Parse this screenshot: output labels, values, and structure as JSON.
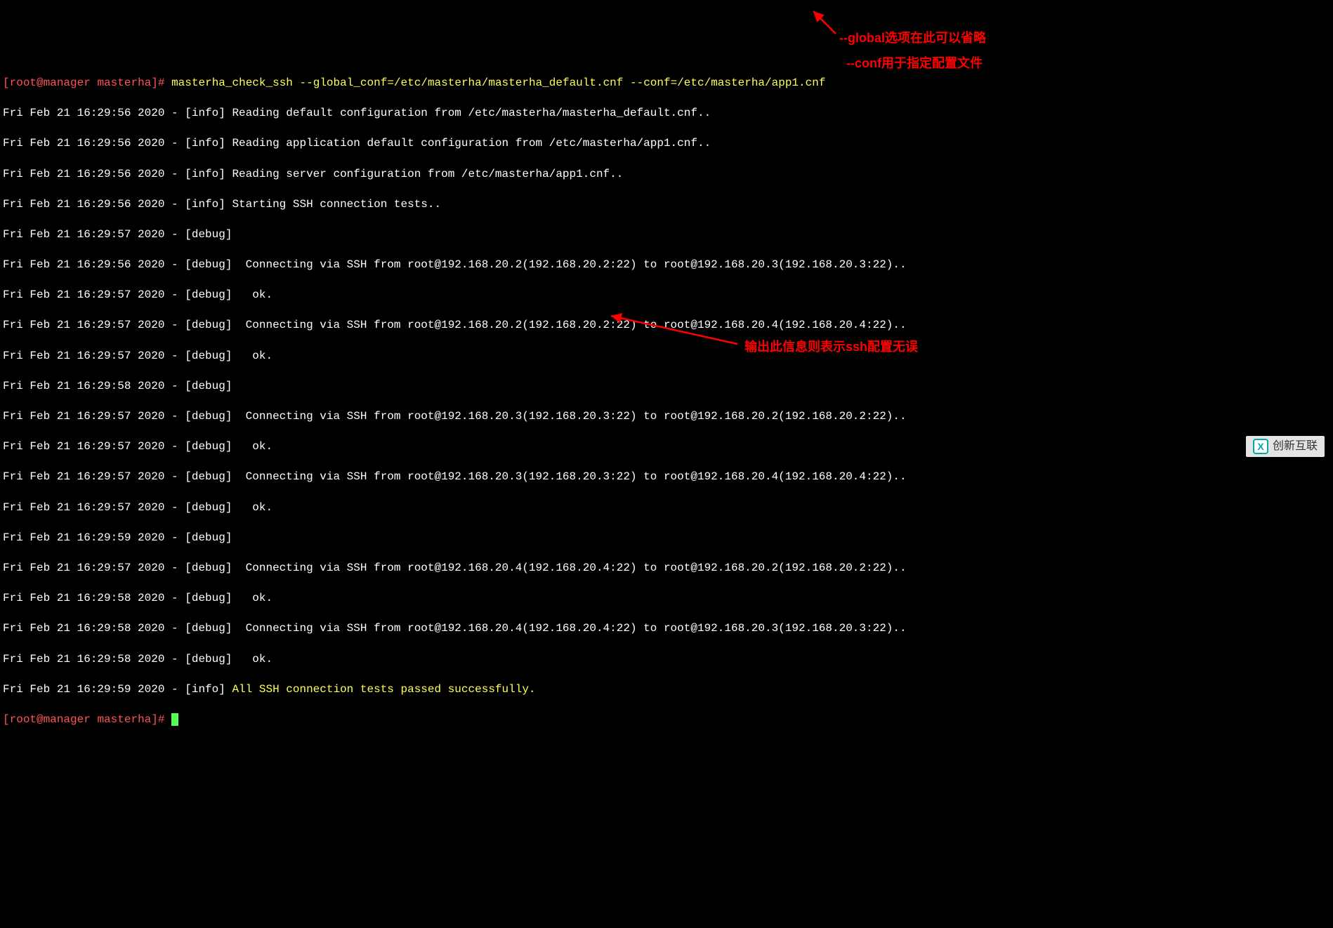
{
  "prompt": {
    "open": "[",
    "user": "root",
    "at": "@",
    "host": "manager",
    "space": " ",
    "path": "masterha",
    "close": "]",
    "hash": "# "
  },
  "command": "masterha_check_ssh --global_conf=/etc/masterha/masterha_default.cnf --conf=/etc/masterha/app1.cnf",
  "lines": [
    "Fri Feb 21 16:29:56 2020 - [info] Reading default configuration from /etc/masterha/masterha_default.cnf..",
    "Fri Feb 21 16:29:56 2020 - [info] Reading application default configuration from /etc/masterha/app1.cnf..",
    "Fri Feb 21 16:29:56 2020 - [info] Reading server configuration from /etc/masterha/app1.cnf..",
    "Fri Feb 21 16:29:56 2020 - [info] Starting SSH connection tests..",
    "Fri Feb 21 16:29:57 2020 - [debug] ",
    "Fri Feb 21 16:29:56 2020 - [debug]  Connecting via SSH from root@192.168.20.2(192.168.20.2:22) to root@192.168.20.3(192.168.20.3:22)..",
    "Fri Feb 21 16:29:57 2020 - [debug]   ok.",
    "Fri Feb 21 16:29:57 2020 - [debug]  Connecting via SSH from root@192.168.20.2(192.168.20.2:22) to root@192.168.20.4(192.168.20.4:22)..",
    "Fri Feb 21 16:29:57 2020 - [debug]   ok.",
    "Fri Feb 21 16:29:58 2020 - [debug] ",
    "Fri Feb 21 16:29:57 2020 - [debug]  Connecting via SSH from root@192.168.20.3(192.168.20.3:22) to root@192.168.20.2(192.168.20.2:22)..",
    "Fri Feb 21 16:29:57 2020 - [debug]   ok.",
    "Fri Feb 21 16:29:57 2020 - [debug]  Connecting via SSH from root@192.168.20.3(192.168.20.3:22) to root@192.168.20.4(192.168.20.4:22)..",
    "Fri Feb 21 16:29:57 2020 - [debug]   ok.",
    "Fri Feb 21 16:29:59 2020 - [debug] ",
    "Fri Feb 21 16:29:57 2020 - [debug]  Connecting via SSH from root@192.168.20.4(192.168.20.4:22) to root@192.168.20.2(192.168.20.2:22)..",
    "Fri Feb 21 16:29:58 2020 - [debug]   ok.",
    "Fri Feb 21 16:29:58 2020 - [debug]  Connecting via SSH from root@192.168.20.4(192.168.20.4:22) to root@192.168.20.3(192.168.20.3:22)..",
    "Fri Feb 21 16:29:58 2020 - [debug]   ok."
  ],
  "final_line_prefix": "Fri Feb 21 16:29:59 2020 - [info] ",
  "final_line_success": "All SSH connection tests passed successfully.",
  "annotations": {
    "a1": "--global选项在此可以省略",
    "a2": "--conf用于指定配置文件",
    "a3": "输出此信息则表示ssh配置无误"
  },
  "watermark": "创新互联"
}
